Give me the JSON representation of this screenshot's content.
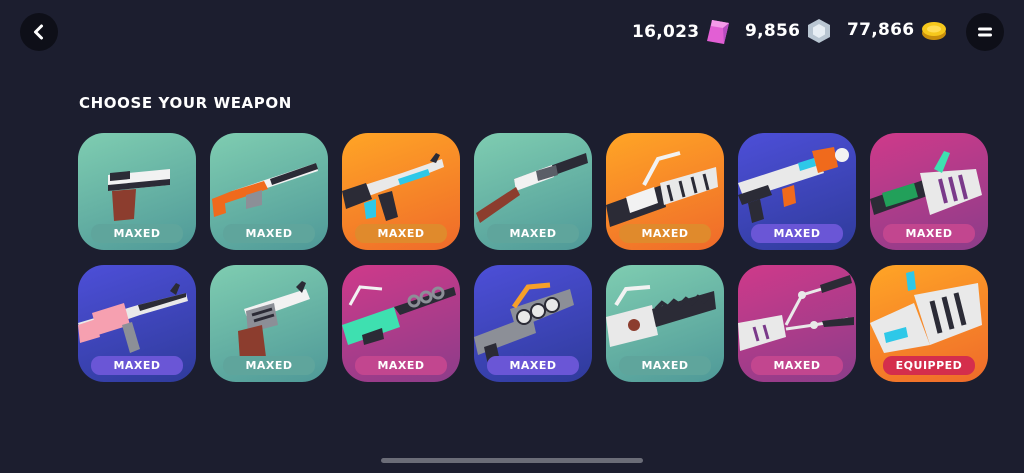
{
  "header": {
    "back_icon": "chevron-left-icon",
    "menu_icon": "equals-menu-icon",
    "currencies": [
      {
        "name": "gems",
        "amount": "16,023",
        "icon": "pink-gem-icon",
        "color": "#e66ad8"
      },
      {
        "name": "crystals",
        "amount": "9,856",
        "icon": "silver-hexagon-icon",
        "color": "#c8d4de"
      },
      {
        "name": "coins",
        "amount": "77,866",
        "icon": "gold-coin-icon",
        "color": "#f2c318"
      }
    ]
  },
  "main": {
    "title": "CHOOSE YOUR WEAPON",
    "weapons": [
      {
        "icon": "pistol-icon",
        "theme": "teal",
        "status": "MAXED"
      },
      {
        "icon": "shotgun-icon",
        "theme": "teal",
        "status": "MAXED"
      },
      {
        "icon": "assault-rifle-icon",
        "theme": "orange",
        "status": "MAXED"
      },
      {
        "icon": "pump-shotgun-icon",
        "theme": "teal",
        "status": "MAXED"
      },
      {
        "icon": "minigun-icon",
        "theme": "orange",
        "status": "MAXED"
      },
      {
        "icon": "rocket-launcher-icon",
        "theme": "blue",
        "status": "MAXED"
      },
      {
        "icon": "blaster-icon",
        "theme": "magenta",
        "status": "MAXED"
      },
      {
        "icon": "m4-rifle-icon",
        "theme": "blue",
        "status": "MAXED"
      },
      {
        "icon": "revolver-icon",
        "theme": "teal",
        "status": "MAXED"
      },
      {
        "icon": "chain-gun-icon",
        "theme": "magenta",
        "status": "MAXED"
      },
      {
        "icon": "grenade-launcher-icon",
        "theme": "blue",
        "status": "MAXED"
      },
      {
        "icon": "chainsaw-icon",
        "theme": "teal",
        "status": "MAXED"
      },
      {
        "icon": "claw-arm-icon",
        "theme": "magenta",
        "status": "MAXED"
      },
      {
        "icon": "heavy-blaster-icon",
        "theme": "orange",
        "status": "EQUIPPED"
      }
    ]
  }
}
